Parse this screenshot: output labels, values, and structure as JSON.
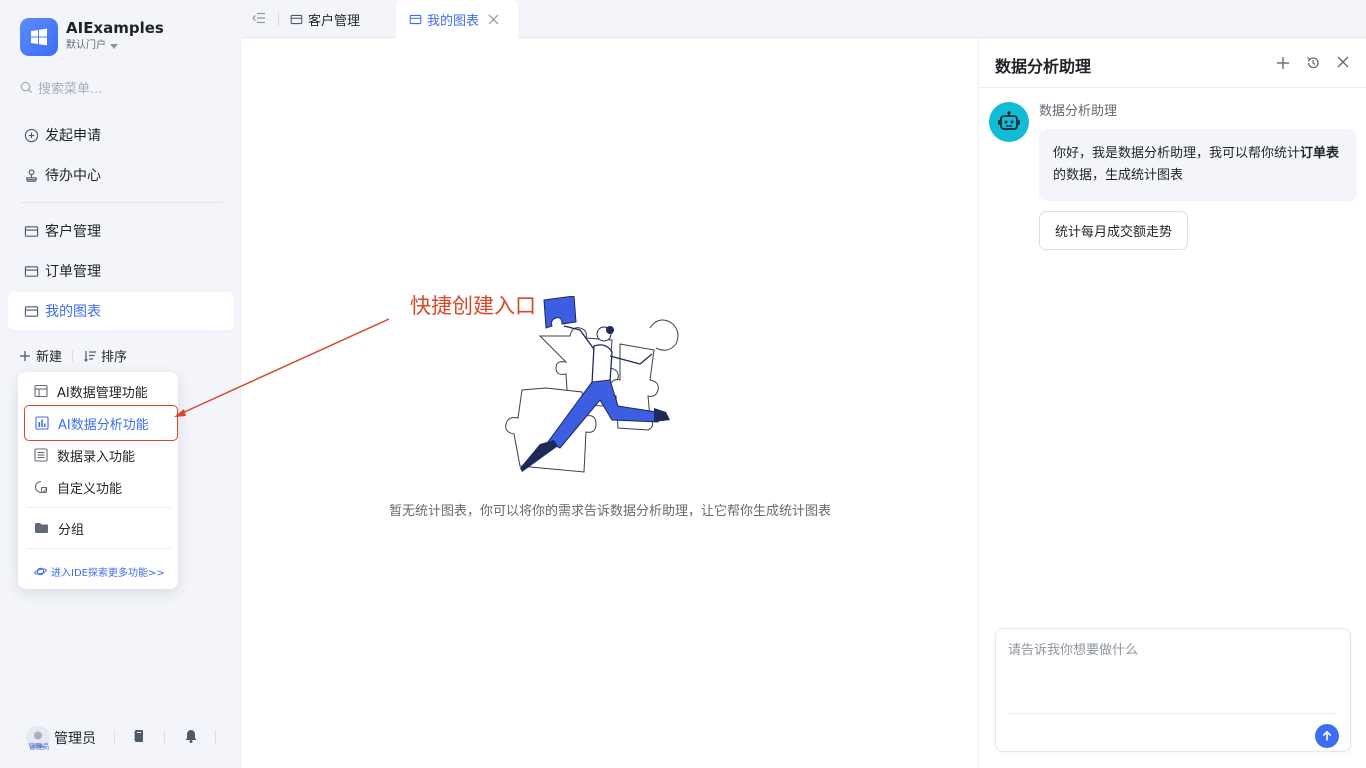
{
  "brand": {
    "name": "AIExamples",
    "portal": "默认门户"
  },
  "search": {
    "placeholder": "搜索菜单..."
  },
  "sidebar": {
    "items": [
      {
        "label": "发起申请"
      },
      {
        "label": "待办中心"
      },
      {
        "label": "客户管理"
      },
      {
        "label": "订单管理"
      },
      {
        "label": "我的图表"
      }
    ],
    "new_label": "新建",
    "sort_label": "排序"
  },
  "dropdown": {
    "items": [
      {
        "label": "AI数据管理功能"
      },
      {
        "label": "AI数据分析功能"
      },
      {
        "label": "数据录入功能"
      },
      {
        "label": "自定义功能"
      },
      {
        "label": "分组"
      }
    ],
    "ide_link": "进入IDE探索更多功能>>"
  },
  "footer": {
    "user_name": "管理员",
    "avatar_caption": "管理员"
  },
  "tabs": [
    {
      "label": "客户管理"
    },
    {
      "label": "我的图表"
    }
  ],
  "main": {
    "annotation": "快捷创建入口",
    "empty_text": "暂无统计图表，你可以将你的需求告诉数据分析助理，让它帮你生成统计图表"
  },
  "panel": {
    "title": "数据分析助理",
    "bot_name": "数据分析助理",
    "message_parts": [
      "你好，我是数据分析助理，我可以帮你统计",
      "订单表",
      "的数据，生成统计图表"
    ],
    "suggestion": "统计每月成交额走势",
    "input_placeholder": "请告诉我你想要做什么"
  },
  "colors": {
    "accent": "#3d6df2",
    "annotation": "#d9472b",
    "bot": "#12bcd4",
    "sidebar_bg": "#f3f5fa"
  }
}
